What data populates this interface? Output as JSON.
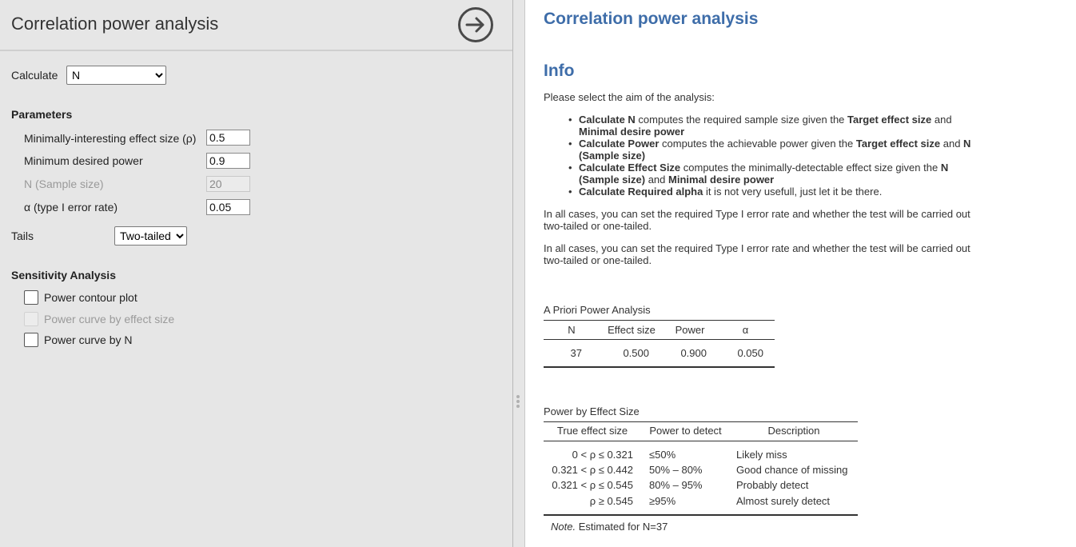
{
  "options_panel": {
    "title": "Correlation power analysis",
    "calculate": {
      "label": "Calculate",
      "selected": "N"
    },
    "parameters": {
      "heading": "Parameters",
      "effect_size": {
        "label": "Minimally-interesting effect size (ρ)",
        "value": "0.5"
      },
      "power": {
        "label": "Minimum desired power",
        "value": "0.9"
      },
      "sample_size": {
        "label": "N (Sample size)",
        "value": "20"
      },
      "alpha": {
        "label": "α (type I error rate)",
        "value": "0.05"
      }
    },
    "tails": {
      "label": "Tails",
      "selected": "Two-tailed"
    },
    "sensitivity": {
      "heading": "Sensitivity Analysis",
      "options": [
        {
          "label": "Power contour plot",
          "checked": false,
          "enabled": true
        },
        {
          "label": "Power curve by effect size",
          "checked": false,
          "enabled": false
        },
        {
          "label": "Power curve by N",
          "checked": false,
          "enabled": true
        }
      ]
    },
    "run_icon": "arrow-right-circle-icon"
  },
  "results": {
    "title": "Correlation power analysis",
    "info": {
      "heading": "Info",
      "intro": "Please select the aim of the analysis:",
      "items": [
        {
          "b1": "Calculate N",
          "t1": " computes the required sample size given the ",
          "b2": "Target effect size",
          "t2": " and ",
          "b3": "Minimal desire power",
          "t3": ""
        },
        {
          "b1": "Calculate Power",
          "t1": " computes the achievable power given the ",
          "b2": "Target effect size",
          "t2": " and ",
          "b3": "N (Sample size)",
          "t3": ""
        },
        {
          "b1": "Calculate Effect Size",
          "t1": " computes the minimally-detectable effect size given the ",
          "b2": "N (Sample size)",
          "t2": " and ",
          "b3": "Minimal desire power",
          "t3": ""
        },
        {
          "b1": "Calculate Required alpha",
          "t1": " it is not very usefull, just let it be there.",
          "b2": "",
          "t2": "",
          "b3": "",
          "t3": ""
        }
      ],
      "paragraph1": "In all cases, you can set the required Type I error rate and whether the test will be carried out two-tailed or one-tailed.",
      "paragraph2": "In all cases, you can set the required Type I error rate and whether the test will be carried out two-tailed or one-tailed."
    },
    "apriori": {
      "caption": "A Priori Power Analysis",
      "columns": [
        "N",
        "Effect size",
        "Power",
        "α"
      ],
      "row": [
        "37",
        "0.500",
        "0.900",
        "0.050"
      ]
    },
    "power_by_es": {
      "caption": "Power by Effect Size",
      "columns": [
        "True effect size",
        "Power to detect",
        "Description"
      ],
      "rows": [
        [
          "0 < ρ ≤ 0.321",
          "≤50%",
          "Likely miss"
        ],
        [
          "0.321 < ρ ≤ 0.442",
          "50% – 80%",
          "Good chance of missing"
        ],
        [
          "0.321 < ρ ≤ 0.545",
          "80% – 95%",
          "Probably detect"
        ],
        [
          "ρ ≥ 0.545",
          "≥95%",
          "Almost surely detect"
        ]
      ],
      "note_prefix": "Note.",
      "note_text": " Estimated for N=37"
    }
  }
}
